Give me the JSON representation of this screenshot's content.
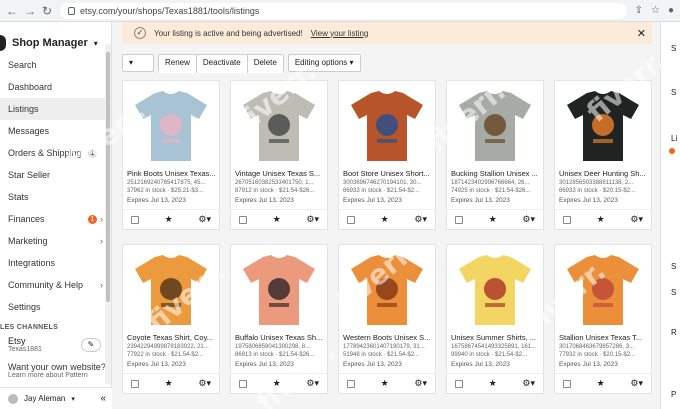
{
  "browser": {
    "url": "etsy.com/your/shops/Texas1881/tools/listings"
  },
  "sidebar": {
    "title": "Shop Manager",
    "items": [
      {
        "label": "Search"
      },
      {
        "label": "Dashboard"
      },
      {
        "label": "Listings"
      },
      {
        "label": "Messages"
      },
      {
        "label": "Orders & Shipping",
        "badge": "1"
      },
      {
        "label": "Star Seller"
      },
      {
        "label": "Stats"
      },
      {
        "label": "Finances",
        "badge": "1"
      },
      {
        "label": "Marketing"
      },
      {
        "label": "Integrations"
      },
      {
        "label": "Community & Help"
      },
      {
        "label": "Settings"
      }
    ],
    "section_label": "LES CHANNELS",
    "channel": {
      "name": "Etsy",
      "sub": "Texas1881"
    },
    "promo": "Want your own website?",
    "promo_sub": "Learn more about Pattern",
    "user": "Jay Aleman"
  },
  "banner": {
    "text": "Your listing is active and being advertised!",
    "link": "View your listing"
  },
  "toolbar": {
    "renew": "Renew",
    "deactivate": "Deactivate",
    "delete": "Delete",
    "editing": "Editing options"
  },
  "listings": [
    {
      "title": "Pink Boots Unisex Texas...",
      "meta": "25121692407654178​75, 45...",
      "stock": "37962 in stock · $25.21-$3...",
      "expires": "Expires Jul 13, 2023",
      "shirt": "#a7c3d4",
      "print": "#e8b4c4"
    },
    {
      "title": "Vintage Unisex Texas S...",
      "meta": "267051603825334017​50, 1...",
      "stock": "87912 in stock · $21.54-$26...",
      "expires": "Expires Jul 13, 2023",
      "shirt": "#bdbdb5",
      "print": "#4a4a4a"
    },
    {
      "title": "Boot Store Unisex Short...",
      "meta": "300369674627019​41​01, 30...",
      "stock": "66933 in stock · $21.54-$2...",
      "expires": "Expires Jul 13, 2023",
      "shirt": "#b8542a",
      "print": "#2a4f8a"
    },
    {
      "title": "Bucking Stallion Unisex ...",
      "meta": "187142340299676​6664, 26...",
      "stock": "74925 in stock · $21.54-$26...",
      "expires": "Expires Jul 13, 2023",
      "shirt": "#a6aba5",
      "print": "#6a4a2a"
    },
    {
      "title": "Unisex Deer Hunting Sh...",
      "meta": "301285650338881​1138, 2...",
      "stock": "66933 in stock · $20.15-$2...",
      "expires": "Expires Jul 13, 2023",
      "shirt": "#1f2321",
      "print": "#e07a2a"
    },
    {
      "title": "Coyote Texas Shirt, Coy...",
      "meta": "239422949998781839​22, 21...",
      "stock": "77922 in stock · $21.54-$2...",
      "expires": "Expires Jul 13, 2023",
      "shirt": "#eb9a3e",
      "print": "#5a3a1a"
    },
    {
      "title": "Buffalo Unisex Texas Sh...",
      "meta": "197580685904​1300298, 8...",
      "stock": "86913 in stock · $21.54-$26...",
      "expires": "Expires Jul 13, 2023",
      "shirt": "#ec9a7e",
      "print": "#3a2a2a"
    },
    {
      "title": "Western Boots Unisex S...",
      "meta": "177894236014​0719​0179, 31...",
      "stock": "51948 in stock · $21.54-$2...",
      "expires": "Expires Jul 13, 2023",
      "shirt": "#ec8f3a",
      "print": "#8a3a1a"
    },
    {
      "title": "Unisex Summer Shirts, ...",
      "meta": "167586745414933​2589​1, 161...",
      "stock": "99940 in stock · $21.54-$2...",
      "expires": "Expires Jul 13, 2023",
      "shirt": "#f2d562",
      "print": "#b03a2a"
    },
    {
      "title": "Stallion Unisex Texas T...",
      "meta": "301706846367​9​857286, 3...",
      "stock": "77932 in stock · $20.15-$2...",
      "expires": "Expires Jul 13, 2023",
      "shirt": "#ec8f3a",
      "print": "#c04a3a"
    }
  ],
  "watermark": "fiverr."
}
